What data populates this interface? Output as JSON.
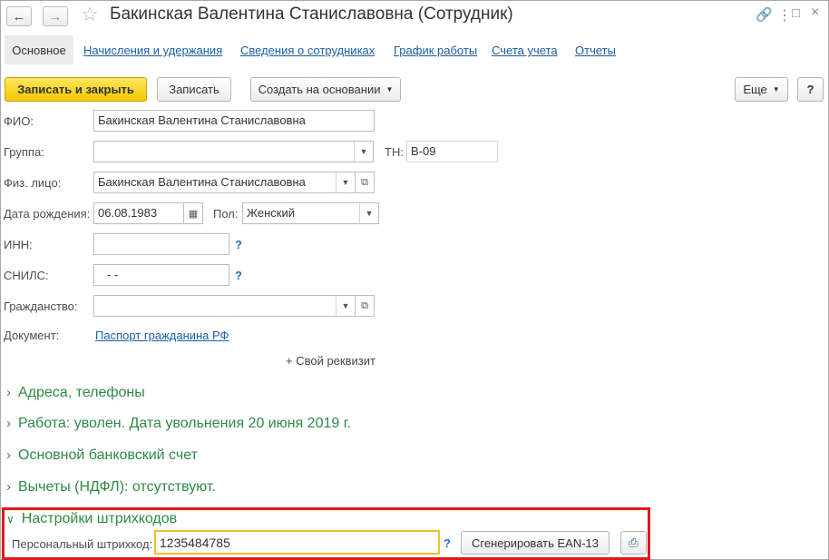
{
  "window": {
    "title": "Бакинская Валентина Станиславовна (Сотрудник)"
  },
  "tabs": [
    {
      "label": "Основное"
    },
    {
      "label": "Начисления и удержания"
    },
    {
      "label": "Сведения о сотрудниках"
    },
    {
      "label": "График работы"
    },
    {
      "label": "Счета учета"
    },
    {
      "label": "Отчеты"
    }
  ],
  "toolbar": {
    "save_close_label": "Записать и закрыть",
    "save_label": "Записать",
    "create_based_label": "Создать на основании",
    "more_label": "Еще",
    "help_label": "?"
  },
  "form": {
    "fio_label": "ФИО:",
    "fio_value": "Бакинская Валентина Станиславовна",
    "group_label": "Группа:",
    "group_value": "",
    "tn_label": "ТН:",
    "tn_value": "В-09",
    "person_label": "Физ. лицо:",
    "person_value": "Бакинская Валентина Станиславовна",
    "birth_label": "Дата рождения:",
    "birth_value": "06.08.1983",
    "gender_label": "Пол:",
    "gender_value": "Женский",
    "inn_label": "ИНН:",
    "inn_value": "",
    "snils_label": "СНИЛС:",
    "snils_value": "-   -",
    "citizenship_label": "Гражданство:",
    "citizenship_value": "",
    "document_label": "Документ:",
    "document_link": "Паспорт гражданина РФ",
    "custom_attr_label": "+ Свой реквизит",
    "help_mark": "?"
  },
  "groups": [
    {
      "label": "Адреса, телефоны",
      "expanded": false
    },
    {
      "label": "Работа: уволен. Дата увольнения 20 июня 2019 г.",
      "expanded": false
    },
    {
      "label": "Основной банковский счет",
      "expanded": false
    },
    {
      "label": "Вычеты (НДФЛ): отсутствуют.",
      "expanded": false
    }
  ],
  "barcode": {
    "group_label": "Настройки штрихкодов",
    "field_label": "Персональный штрихкод:",
    "field_value": "1235484785",
    "generate_label": "Сгенерировать EAN-13"
  },
  "icons": {
    "back": "arrow-left-icon",
    "forward": "arrow-right-icon",
    "favorite": "star-icon",
    "link": "link-icon",
    "menu": "more-vertical-icon",
    "maximize": "maximize-icon",
    "close": "close-icon",
    "calendar": "calendar-icon",
    "print": "printer-icon"
  },
  "colors": {
    "primary_button": "#f3c800",
    "link": "#1b5ea6",
    "group_header": "#2e8a46",
    "highlight_border": "#e0181b",
    "active_input_border": "#f0c030"
  }
}
